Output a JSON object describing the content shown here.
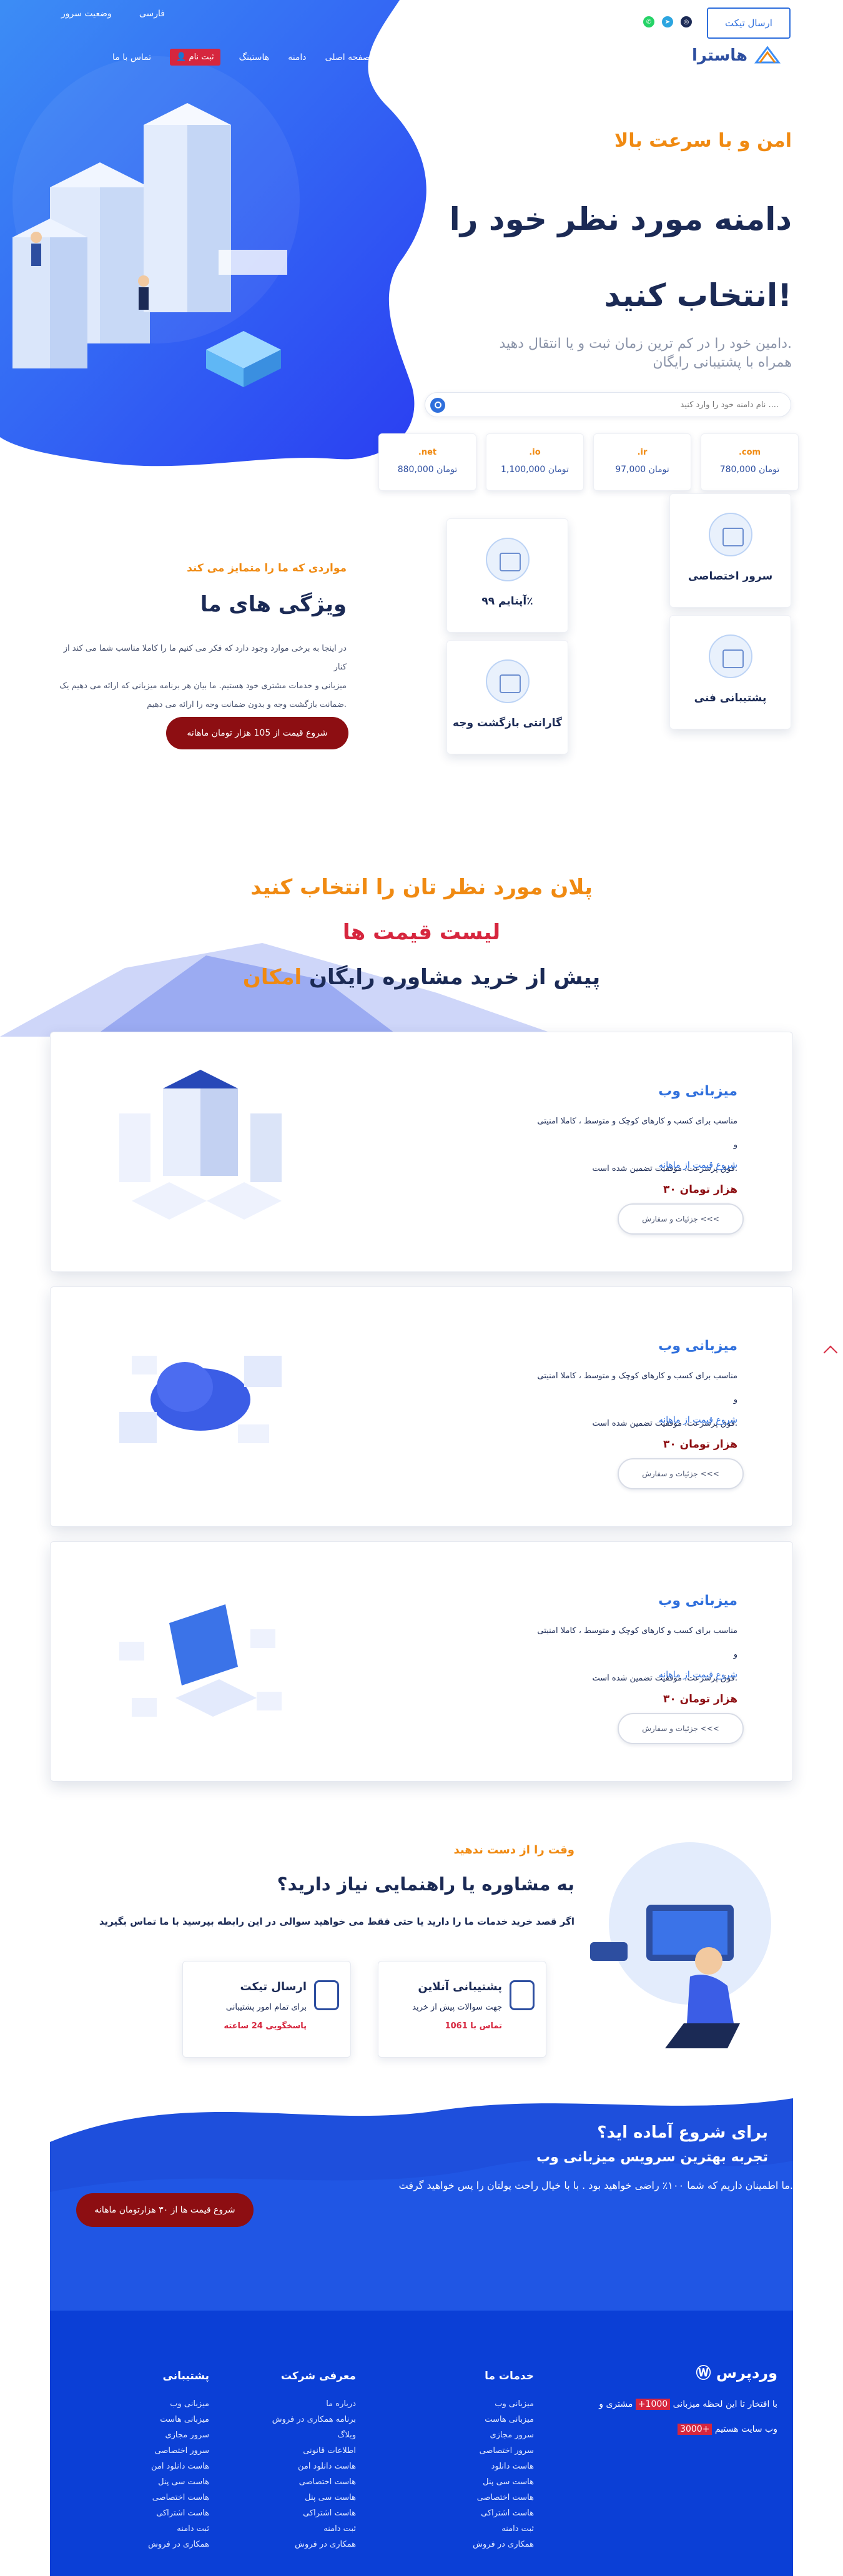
{
  "top": {
    "links": [
      "فارسی",
      "وضعیت سرور"
    ],
    "ticket_button": "ارسال تیکت",
    "social_icons": [
      "whatsapp-icon",
      "telegram-icon",
      "instagram-icon"
    ]
  },
  "nav": {
    "items": [
      "صفحه اصلی",
      "دامنه",
      "هاستینگ",
      "ثبت نام",
      "تماس با ما"
    ],
    "register_icon": "user-icon"
  },
  "logo": {
    "text": "هاسترا"
  },
  "hero": {
    "kicker": "امن و با سرعت بالا",
    "title_line1": "دامنه مورد نظر خود را",
    "title_line2": "انتخاب کنید!",
    "subtitle_line1": "دامین خود را در کم ترین زمان ثبت و یا انتقال دهید.",
    "subtitle_line2": "همراه با پشتیبانی رایگان",
    "search_placeholder": "نام دامنه خود را وارد کنید ....",
    "tlds": [
      {
        "ext": ".com",
        "price": "780,000 تومان"
      },
      {
        "ext": ".ir",
        "price": "97,000 تومان"
      },
      {
        "ext": ".io",
        "price": "1,100,000 تومان"
      },
      {
        "ext": ".net",
        "price": "880,000 تومان"
      }
    ]
  },
  "features": {
    "kicker": "مواردی که ما را متمایز می کند",
    "title": "ویژگی های ما",
    "desc_line1": "در اینجا به برخی موارد وجود دارد که فکر می کنیم ما را کاملا مناسب شما می کند از کنار",
    "desc_line2": "میزبانی و خدمات مشتری خود هستیم. ما بیان هر برنامه میزبانی که ارائه می دهیم یک",
    "desc_line3": "ضمانت بازگشت وجه و بدون ضمانت وجه را ارائه می دهیم.",
    "button": "شروع قیمت از 105 هزار تومان ماهانه",
    "cards": [
      {
        "label": "سرور اختصاصی",
        "icon": "server-icon"
      },
      {
        "label": "آپتایم ۹۹٪",
        "icon": "uptime-icon"
      },
      {
        "label": "پشتیبانی فنی",
        "icon": "support-icon"
      },
      {
        "label": "گارانتی بازگشت وجه",
        "icon": "guarantee-icon"
      }
    ]
  },
  "plans": {
    "line1": "پلان مورد نظر تان را انتخاب کنید",
    "line2": "لیست قیمت ها",
    "line3_a": "امکان",
    "line3_b": "مشاوره رایگان",
    "line3_c": "پیش از خرید",
    "items": [
      {
        "name": "میزبانی وب",
        "desc_line1": "مناسب برای کسب و کارهای کوچک و متوسط ، کاملا امنیتی و",
        "desc_line2": "فوق پرسرعت. موفقیت تضمین شده است.",
        "start": "شروع قیمت از ماهانه",
        "price": "۳۰ هزار تومان",
        "details": "جزئیات و سفارش <<<"
      },
      {
        "name": "میزبانی وب",
        "desc_line1": "مناسب برای کسب و کارهای کوچک و متوسط ، کاملا امنیتی و",
        "desc_line2": "فوق پرسرعت. موفقیت تضمین شده است.",
        "start": "شروع قیمت از ماهانه",
        "price": "۳۰ هزار تومان",
        "details": "جزئیات و سفارش <<<"
      },
      {
        "name": "میزبانی وب",
        "desc_line1": "مناسب برای کسب و کارهای کوچک و متوسط ، کاملا امنیتی و",
        "desc_line2": "فوق پرسرعت. موفقیت تضمین شده است.",
        "start": "شروع قیمت از ماهانه",
        "price": "۳۰ هزار تومان",
        "details": "جزئیات و سفارش <<<"
      }
    ]
  },
  "consult": {
    "kicker": "وقت را از دست ندهید",
    "title": "به مشاوره یا راهنمایی نیاز دارید؟",
    "desc": "اگر قصد خرید خدمات ما را دارید یا حتی فقط می خواهید سوالی در این رابطه بپرسید با ما تماس بگیرید",
    "cards": [
      {
        "title": "پشتیبانی آنلاین",
        "sub": "جهت سوالات پیش از خرید",
        "hint": "تماس با 1061",
        "icon": "headset-icon"
      },
      {
        "title": "ارسال تیکت",
        "sub": "برای تمام امور پشتیبانی",
        "hint": "پاسخگویی 24 ساعته",
        "icon": "ticket-icon"
      }
    ]
  },
  "cta": {
    "title": "برای شروع آماده اید؟",
    "subtitle": "تجربه بهترین سرویس میزبانی وب",
    "line": "ما اطمینان داریم که شما ۱۰۰٪ راضی خواهید بود . با با خیال راحت پولتان را پس خواهید گرفت.",
    "button": "شروع قیمت ها از ۳۰ هزارتومان ماهانه"
  },
  "footer": {
    "logo": "وردپرس",
    "about_line1": "با افتخار تا این لحظه میزبانی",
    "about_highlight1": "1000+",
    "about_line1b": "مشتری و",
    "about_highlight2": "3000+",
    "about_line2": "وب سایت هستیم",
    "columns": [
      {
        "title": "خدمات ما",
        "links": [
          "میزبانی وب",
          "میزبانی هاست",
          "سرور مجازی",
          "سرور اختصاصی",
          "هاست دانلود",
          "هاست سی پنل",
          "هاست اختصاصی",
          "هاست اشتراکی",
          "ثبت دامنه",
          "همکاری در فروش"
        ]
      },
      {
        "title": "معرفی شرکت",
        "links": [
          "درباره ما",
          "برنامه همکاری در فروش",
          "وبلاگ",
          "اطلاعات قانونی",
          "هاست دانلود امن",
          "هاست اختصاصی",
          "هاست سی پنل",
          "هاست اشتراکی",
          "ثبت دامنه",
          "همکاری در فروش"
        ]
      },
      {
        "title": "پشتیبانی",
        "links": [
          "میزبانی وب",
          "میزبانی هاست",
          "سرور مجازی",
          "سرور اختصاصی",
          "هاست دانلود امن",
          "هاست سی پنل",
          "هاست اختصاصی",
          "هاست اشتراکی",
          "ثبت دامنه",
          "همکاری در فروش"
        ]
      }
    ]
  },
  "colors": {
    "primary": "#2f6fdc",
    "accent_orange": "#f08a12",
    "accent_red": "#d6263e",
    "dark_red": "#8d0e12",
    "navy": "#1b2a55",
    "footer_blue": "#0b3fd6"
  }
}
